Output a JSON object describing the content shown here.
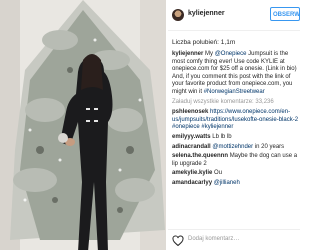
{
  "header": {
    "username": "kyliejenner",
    "follow_label": "OBSERWUJ"
  },
  "likes": "Liczba polubień: 1,1m",
  "caption": {
    "user": "kyliejenner",
    "text_1": " My ",
    "mention_1": "@Onepiece",
    "text_2": " Jumpsuit is the most comfy thing ever! Use code KYLIE at onepiece.com for $25 off a onesie. (Link in bio) And, if you comment this post with the link of your favorite product from onepiece.com, you might win it ",
    "hashtag": "#NorwegianStreetwear"
  },
  "load_more": "Załaduj wszystkie komentarze: 33,236",
  "comments": [
    {
      "user": "pshleenosek",
      "text": "https://www.onepiece.com/en-us/jumpsuits/traditions/lusekofte-onesie-black-2 ",
      "tag": "#onepiece #kyliejenner"
    },
    {
      "user": "emilyyy.watts",
      "text": "Lb lb lb",
      "tag": ""
    },
    {
      "user": "adinacrandall",
      "text": "",
      "tag": "@mottizehnder",
      "after": " in 20 years"
    },
    {
      "user": "selena.the.queennn",
      "text": "Maybe the dog can use a lip upgrade 2",
      "tag": ""
    },
    {
      "user": "amekylie.kylie",
      "text": "Ou",
      "tag": ""
    },
    {
      "user": "amandacarlyy",
      "text": "",
      "tag": "@jillianeh"
    }
  ],
  "footer": {
    "comment_placeholder": "Dodaj komentarz…",
    "icon": "heart-icon"
  },
  "colors": {
    "accent": "#3897f0",
    "mention": "#003569",
    "muted": "#999999"
  }
}
